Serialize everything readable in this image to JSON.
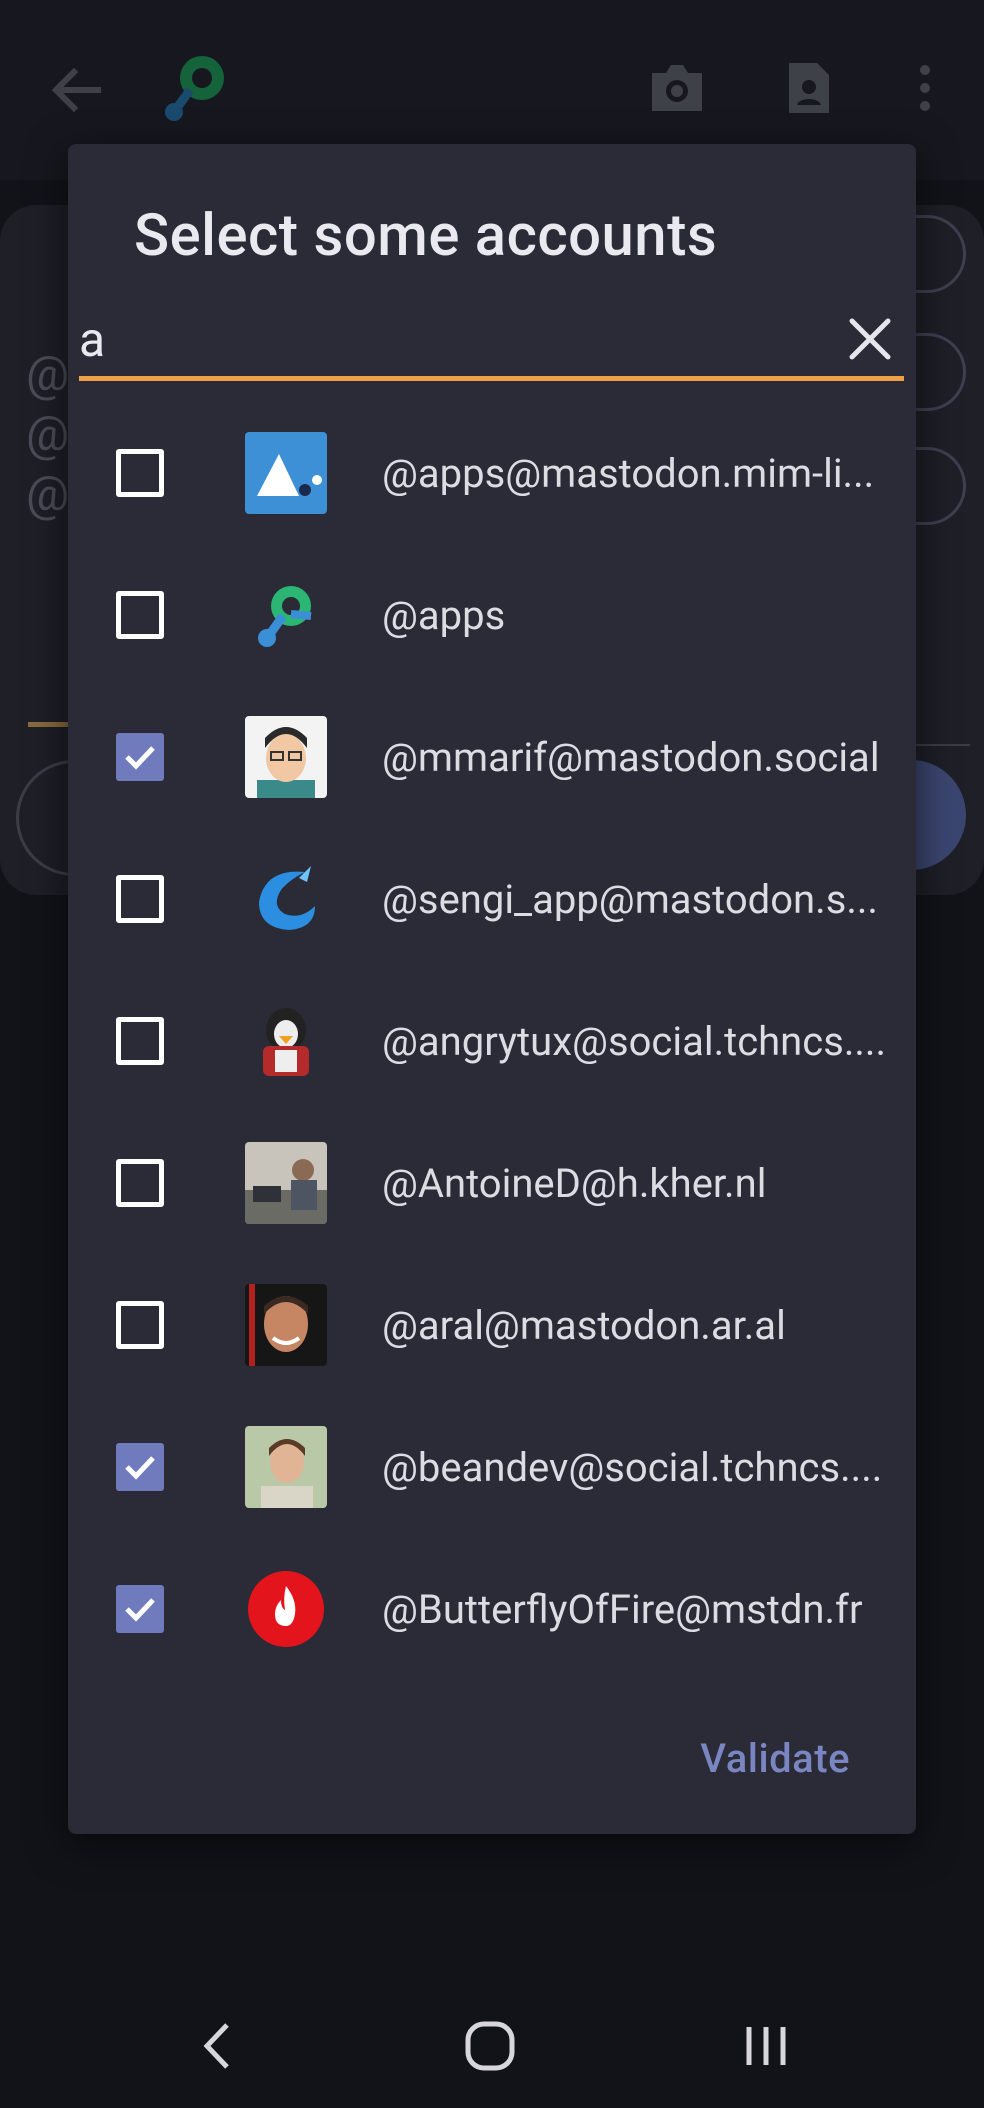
{
  "colors": {
    "background": "#121319",
    "dialog": "#2a2b37",
    "accent_underline": "#f0a046",
    "checkbox_checked": "#6f7bbd",
    "validate_text": "#7a86c2"
  },
  "background_app": {
    "back_icon": "arrow-left-icon",
    "logo_icon": "fedilab-logo-icon",
    "camera_icon": "camera-icon",
    "contact_icon": "contact-card-icon",
    "menu_icon": "more-vertical-icon",
    "partial_text": [
      "@",
      "@",
      "@"
    ]
  },
  "dialog": {
    "title": "Select some accounts",
    "search": {
      "value": "a",
      "placeholder": ""
    },
    "clear_icon": "close-icon",
    "accounts": [
      {
        "handle": "@apps@mastodon.mim-li...",
        "checked": false,
        "avatar": "mim-libre-avatar"
      },
      {
        "handle": "@apps",
        "checked": false,
        "avatar": "fedilab-avatar"
      },
      {
        "handle": "@mmarif@mastodon.social",
        "checked": true,
        "avatar": "cartoon-man-avatar"
      },
      {
        "handle": "@sengi_app@mastodon.s...",
        "checked": false,
        "avatar": "sengi-avatar"
      },
      {
        "handle": "@angrytux@social.tchncs....",
        "checked": false,
        "avatar": "angry-tux-avatar"
      },
      {
        "handle": "@AntoineD@h.kher.nl",
        "checked": false,
        "avatar": "photo-avatar"
      },
      {
        "handle": "@aral@mastodon.ar.al",
        "checked": false,
        "avatar": "photo-avatar"
      },
      {
        "handle": "@beandev@social.tchncs....",
        "checked": true,
        "avatar": "photo-avatar"
      },
      {
        "handle": "@ButterflyOfFire@mstdn.fr",
        "checked": true,
        "avatar": "fire-avatar"
      }
    ],
    "validate_label": "Validate"
  },
  "navbar": {
    "back_icon": "nav-back-icon",
    "home_icon": "nav-home-icon",
    "recents_icon": "nav-recents-icon"
  }
}
